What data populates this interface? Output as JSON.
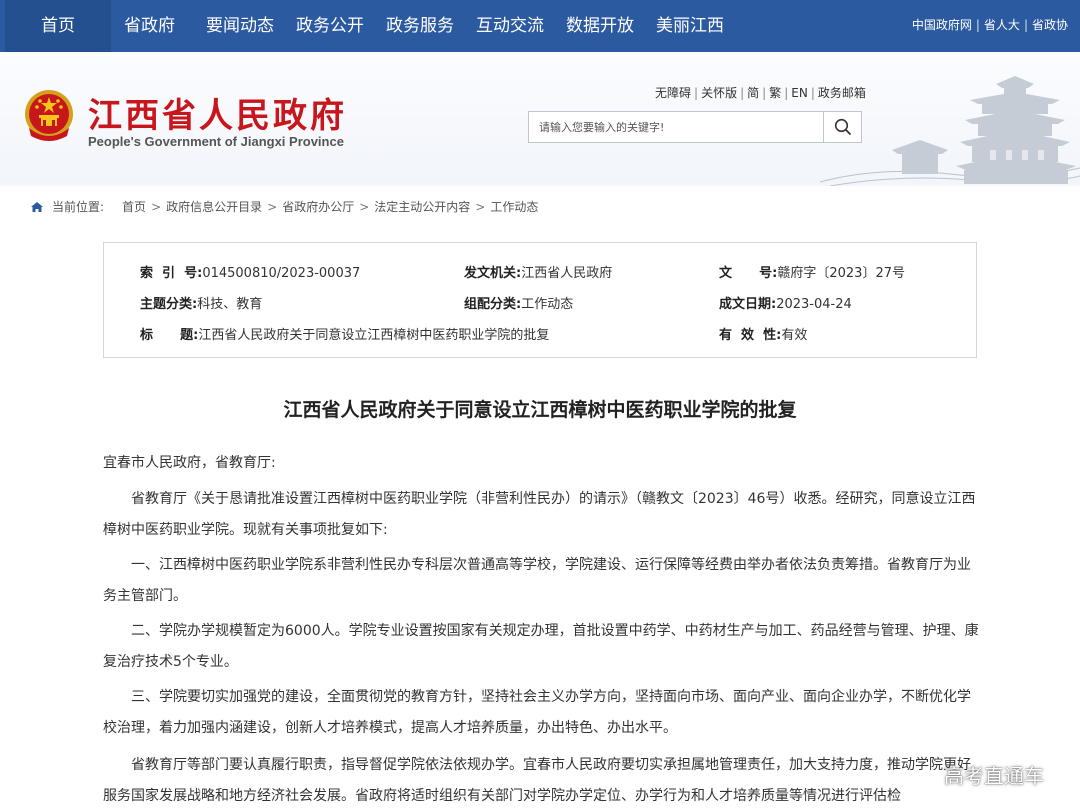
{
  "nav": {
    "items": [
      "首页",
      "省政府",
      "要闻动态",
      "政务公开",
      "政务服务",
      "互动交流",
      "数据开放",
      "美丽江西"
    ],
    "links": [
      "中国政府网",
      "省人大",
      "省政协"
    ]
  },
  "header": {
    "title": "江西省人民政府",
    "subtitle": "People's Government of Jiangxi Province",
    "utility": [
      "无障碍",
      "关怀版",
      "简",
      "繁",
      "EN",
      "政务邮箱"
    ],
    "search_placeholder": "请输入您要输入的关键字!"
  },
  "breadcrumb": {
    "label": "当前位置:",
    "items": [
      "首页",
      "政府信息公开目录",
      "省政府办公厅",
      "法定主动公开内容",
      "工作动态"
    ]
  },
  "meta": {
    "index_label": "索  引  号:",
    "index_value": "014500810/2023-00037",
    "issuer_label": "发文机关:",
    "issuer_value": "江西省人民政府",
    "docno_label": "文      号:",
    "docno_value": "赣府字〔2023〕27号",
    "category_label": "主题分类:",
    "category_value": "科技、教育",
    "group_label": "组配分类:",
    "group_value": "工作动态",
    "date_label": "成文日期:",
    "date_value": "2023-04-24",
    "title_label": "标      题:",
    "title_value": "江西省人民政府关于同意设立江西樟树中医药职业学院的批复",
    "validity_label": "有  效  性:",
    "validity_value": "有效"
  },
  "article": {
    "title": "江西省人民政府关于同意设立江西樟树中医药职业学院的批复",
    "salutation": "宜春市人民政府，省教育厅:",
    "paragraphs": [
      "省教育厅《关于恳请批准设置江西樟树中医药职业学院（非营利性民办）的请示》（赣教文〔2023〕46号）收悉。经研究，同意设立江西樟树中医药职业学院。现就有关事项批复如下:",
      "一、江西樟树中医药职业学院系非营利性民办专科层次普通高等学校，学院建设、运行保障等经费由举办者依法负责筹措。省教育厅为业务主管部门。",
      "二、学院办学规模暂定为6000人。学院专业设置按国家有关规定办理，首批设置中药学、中药材生产与加工、药品经营与管理、护理、康复治疗技术5个专业。",
      "三、学院要切实加强党的建设，全面贯彻党的教育方针，坚持社会主义办学方向，坚持面向市场、面向产业、面向企业办学，不断优化学校治理，着力加强内涵建设，创新人才培养模式，提高人才培养质量，办出特色、办出水平。",
      "省教育厅等部门要认真履行职责，指导督促学院依法依规办学。宜春市人民政府要切实承担属地管理责任，加大支持力度，推动学院更好服务国家发展战略和地方经济社会发展。省政府将适时组织有关部门对学院办学定位、办学行为和人才培养质量等情况进行评估检"
    ]
  },
  "watermark": "高考直通车"
}
